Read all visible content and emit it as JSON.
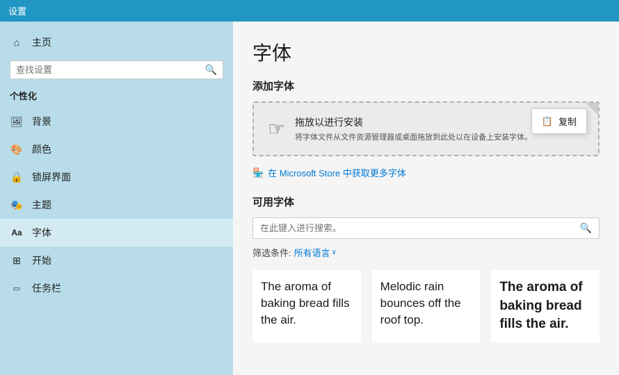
{
  "titleBar": {
    "label": "设置"
  },
  "sidebar": {
    "searchPlaceholder": "查找设置",
    "sectionTitle": "个性化",
    "items": [
      {
        "id": "home",
        "icon": "⌂",
        "label": "主页"
      },
      {
        "id": "background",
        "icon": "🖼",
        "label": "背景"
      },
      {
        "id": "color",
        "icon": "🎨",
        "label": "颜色"
      },
      {
        "id": "lockscreen",
        "icon": "🔒",
        "label": "锁屏界面"
      },
      {
        "id": "theme",
        "icon": "🎭",
        "label": "主题"
      },
      {
        "id": "fonts",
        "icon": "Aa",
        "label": "字体",
        "active": true
      },
      {
        "id": "start",
        "icon": "⊞",
        "label": "开始"
      },
      {
        "id": "taskbar",
        "icon": "▭",
        "label": "任务栏"
      }
    ]
  },
  "content": {
    "pageTitle": "字体",
    "addFontsTitle": "添加字体",
    "dropZone": {
      "mainText": "拖放以进行安装",
      "subText": "将字体文件从文件资源管理器或桌面拖放到此处以在设备上安装字体。"
    },
    "tooltip": {
      "icon": "📋",
      "text": "复制"
    },
    "storeLink": "在 Microsoft Store 中获取更多字体",
    "availableFontsTitle": "可用字体",
    "searchPlaceholder": "在此键入进行搜索。",
    "filterLabel": "筛选条件:",
    "filterValue": "所有语言",
    "fontPreviews": [
      {
        "text": "The aroma of baking bread fills the air.",
        "style": "normal"
      },
      {
        "text": "Melodic rain bounces off the roof top.",
        "style": "normal"
      },
      {
        "text": "The aroma of baking bread fills the air.",
        "style": "bold"
      }
    ]
  }
}
